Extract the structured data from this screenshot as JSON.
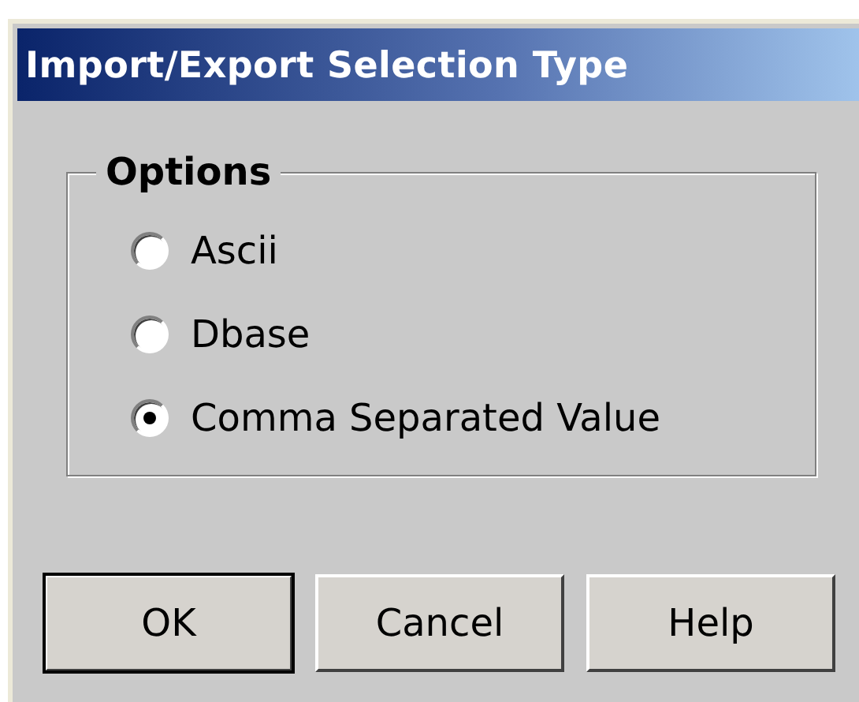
{
  "window": {
    "title": "Import/Export Selection Type"
  },
  "options": {
    "label": "Options",
    "items": [
      {
        "label": "Ascii",
        "selected": false
      },
      {
        "label": "Dbase",
        "selected": false
      },
      {
        "label": "Comma Separated Value",
        "selected": true
      }
    ]
  },
  "buttons": [
    {
      "label": "OK",
      "default": true
    },
    {
      "label": "Cancel",
      "default": false
    },
    {
      "label": "Help",
      "default": false
    }
  ]
}
